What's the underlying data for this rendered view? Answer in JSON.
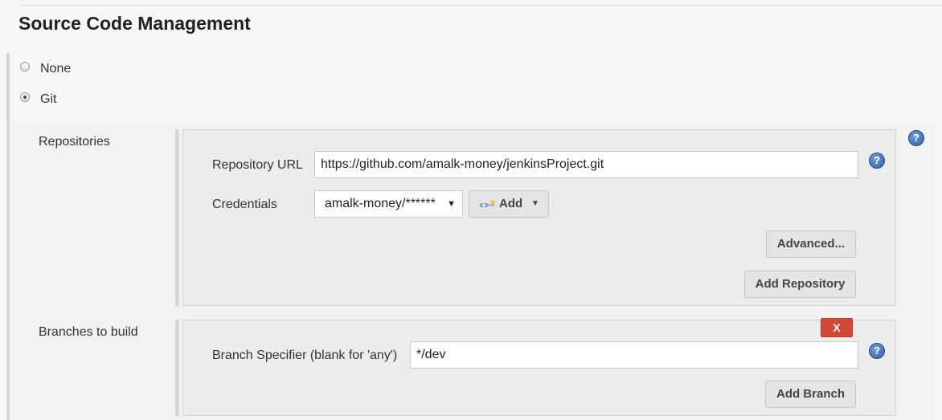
{
  "section": {
    "title": "Source Code Management"
  },
  "scm_options": {
    "none_label": "None",
    "git_label": "Git",
    "selected": "Git"
  },
  "git": {
    "help_icon": "?",
    "repositories": {
      "label": "Repositories",
      "url_label": "Repository URL",
      "url_value": "https://github.com/amalk-money/jenkinsProject.git",
      "credentials_label": "Credentials",
      "credentials_value": "amalk-money/******",
      "add_label": "Add",
      "advanced_label": "Advanced...",
      "add_repository_label": "Add Repository"
    },
    "branches": {
      "label": "Branches to build",
      "delete_label": "X",
      "specifier_label": "Branch Specifier (blank for 'any')",
      "specifier_value": "*/dev",
      "add_branch_label": "Add Branch"
    }
  },
  "colors": {
    "delete_button": "#d24939",
    "help_icon": "#2f5f9f",
    "page_background": "#f6f6f6"
  }
}
